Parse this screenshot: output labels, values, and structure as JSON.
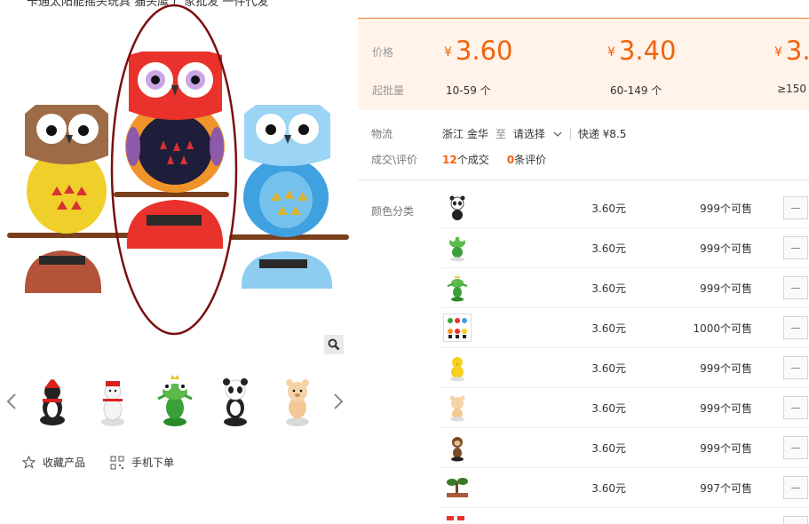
{
  "title_partial": "卡通太阳能摇头玩具 猫头鹰 厂家批发 一件代发",
  "gallery": {
    "zoom_icon": "magnifier-icon",
    "thumbnails": [
      {
        "name": "penguin-thumbnail"
      },
      {
        "name": "snowman-thumbnail"
      },
      {
        "name": "frog-prince-thumbnail"
      },
      {
        "name": "panda-thumbnail"
      },
      {
        "name": "bear-thumbnail"
      }
    ]
  },
  "actions": {
    "favorite_label": "收藏产品",
    "mobile_label": "手机下单"
  },
  "price_box": {
    "price_label": "价格",
    "moq_label": "起批量",
    "currency": "¥",
    "tiers": [
      {
        "price": "3.60",
        "qty": "10-59 个"
      },
      {
        "price": "3.40",
        "qty": "60-149 个"
      },
      {
        "price": "3.",
        "qty": "≥150"
      }
    ]
  },
  "logistics": {
    "label": "物流",
    "origin": "浙江 金华",
    "to": "至",
    "destination": "请选择",
    "shipping": "快递 ¥8.5"
  },
  "deals": {
    "label": "成交\\评价",
    "deal_count": "12",
    "deal_suffix": "个成交",
    "review_count": "0",
    "review_suffix": "条评价"
  },
  "sku": {
    "label": "颜色分类",
    "rows": [
      {
        "thumb": "panda",
        "price": "3.60元",
        "stock": "999个可售"
      },
      {
        "thumb": "frog",
        "price": "3.60元",
        "stock": "999个可售"
      },
      {
        "thumb": "frog-prince",
        "price": "3.60元",
        "stock": "999个可售"
      },
      {
        "thumb": "assorted",
        "price": "3.60元",
        "stock": "1000个可售"
      },
      {
        "thumb": "chick",
        "price": "3.60元",
        "stock": "999个可售"
      },
      {
        "thumb": "bear",
        "price": "3.60元",
        "stock": "999个可售"
      },
      {
        "thumb": "monkey",
        "price": "3.60元",
        "stock": "999个可售"
      },
      {
        "thumb": "bonsai",
        "price": "3.60元",
        "stock": "997个可售"
      },
      {
        "thumb": "partial",
        "price": "",
        "stock": ""
      }
    ]
  },
  "colors": {
    "accent": "#f0630c",
    "price_bg": "#fff3ea",
    "ellipse": "#7a1010"
  }
}
